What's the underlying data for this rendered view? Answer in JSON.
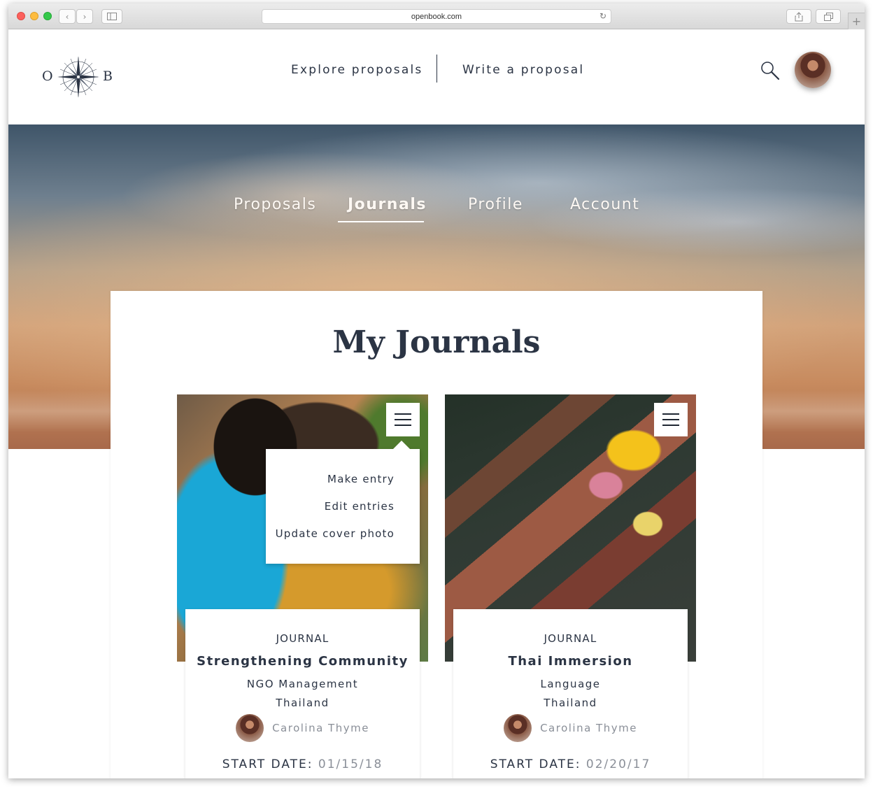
{
  "browser": {
    "url": "openbook.com",
    "back_icon": "chevron-left-icon",
    "forward_icon": "chevron-right-icon",
    "sidebar_icon": "sidebar-icon",
    "reload_icon": "reload-icon",
    "share_icon": "share-icon",
    "tabs_icon": "tabs-icon",
    "new_tab_label": "+"
  },
  "header": {
    "logo_left": "O",
    "logo_right": "B",
    "nav": [
      "Explore proposals",
      "Write a proposal"
    ],
    "search_icon": "search-icon"
  },
  "tabs": [
    {
      "label": "Proposals",
      "active": false
    },
    {
      "label": "Journals",
      "active": true
    },
    {
      "label": "Profile",
      "active": false
    },
    {
      "label": "Account",
      "active": false
    }
  ],
  "page_title": "My Journals",
  "menu": {
    "items": [
      "Make entry",
      "Edit entries",
      "Update cover photo"
    ]
  },
  "journals": [
    {
      "kind": "JOURNAL",
      "title": "Strengthening Community",
      "subject": "NGO Management",
      "location": "Thailand",
      "author": "Carolina Thyme",
      "start_label": "START DATE:",
      "start_date": "01/15/18"
    },
    {
      "kind": "JOURNAL",
      "title": "Thai Immersion",
      "subject": "Language",
      "location": "Thailand",
      "author": "Carolina Thyme",
      "start_label": "START DATE:",
      "start_date": "02/20/17"
    }
  ],
  "colors": {
    "text": "#2b3444",
    "muted": "#8a8f98",
    "hero_top": "#3f5569",
    "hero_bottom": "#a8694a"
  }
}
